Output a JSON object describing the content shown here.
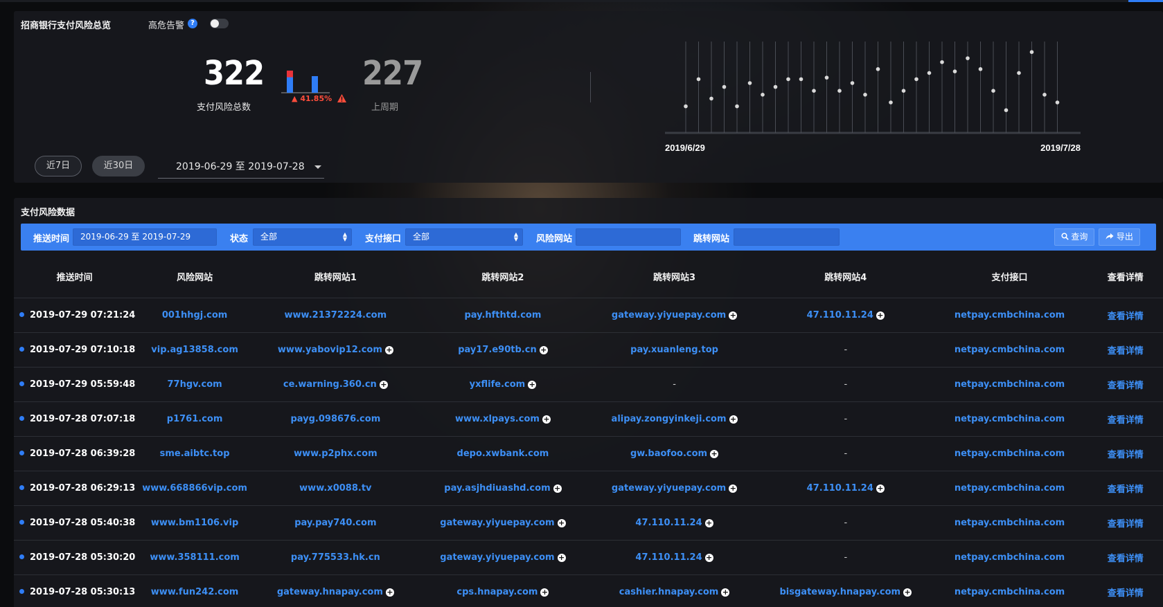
{
  "overview": {
    "title": "招商银行支付风险总览",
    "alert_label": "高危告警",
    "help_glyph": "?",
    "total_value": "322",
    "total_caption": "支付风险总数",
    "change_text": "41.85%",
    "change_bars": [
      0.8,
      0.6
    ],
    "last_value": "227",
    "last_caption": "上周期",
    "timeline_start": "2019/6/29",
    "timeline_end": "2019/7/28",
    "timeline_levels": [
      0.2,
      0.55,
      0.3,
      0.45,
      0.2,
      0.5,
      0.35,
      0.45,
      0.55,
      0.55,
      0.4,
      0.57,
      0.4,
      0.5,
      0.35,
      0.68,
      0.25,
      0.4,
      0.55,
      0.63,
      0.77,
      0.65,
      0.82,
      0.68,
      0.4,
      0.15,
      0.63,
      0.9,
      0.35,
      0.25
    ],
    "btn_7d": "近7日",
    "btn_30d": "近30日",
    "date_range": "2019-06-29 至 2019-07-28"
  },
  "data_panel": {
    "title": "支付风险数据",
    "filters": {
      "push_time_label": "推送时间",
      "push_time_value": "2019-06-29 至 2019-07-29",
      "status_label": "状态",
      "status_value": "全部",
      "interface_label": "支付接口",
      "interface_value": "全部",
      "risk_site_label": "风险网站",
      "jump_site_label": "跳转网站",
      "query_label": "查询",
      "export_label": "导出"
    },
    "columns": [
      "推送时间",
      "风险网站",
      "跳转网站1",
      "跳转网站2",
      "跳转网站3",
      "跳转网站4",
      "支付接口",
      "查看详情"
    ],
    "detail_label": "查看详情",
    "rows": [
      {
        "time": "2019-07-29 07:21:24",
        "risk": "001hhgj.com",
        "j1": "www.21372224.com",
        "j1p": false,
        "j2": "pay.hfthtd.com",
        "j2p": false,
        "j3": "gateway.yiyuepay.com",
        "j3p": true,
        "j4": "47.110.11.24",
        "j4p": true,
        "iface": "netpay.cmbchina.com"
      },
      {
        "time": "2019-07-29 07:10:18",
        "risk": "vip.ag13858.com",
        "j1": "www.yabovip12.com",
        "j1p": true,
        "j2": "pay17.e90tb.cn",
        "j2p": true,
        "j3": "pay.xuanleng.top",
        "j3p": false,
        "j4": "-",
        "j4p": false,
        "iface": "netpay.cmbchina.com"
      },
      {
        "time": "2019-07-29 05:59:48",
        "risk": "77hgv.com",
        "j1": "ce.warning.360.cn",
        "j1p": true,
        "j2": "yxflife.com",
        "j2p": true,
        "j3": "-",
        "j3p": false,
        "j4": "-",
        "j4p": false,
        "iface": "netpay.cmbchina.com"
      },
      {
        "time": "2019-07-28 07:07:18",
        "risk": "p1761.com",
        "j1": "payg.098676.com",
        "j1p": false,
        "j2": "www.xlpays.com",
        "j2p": true,
        "j3": "alipay.zongyinkeji.com",
        "j3p": true,
        "j4": "-",
        "j4p": false,
        "iface": "netpay.cmbchina.com"
      },
      {
        "time": "2019-07-28 06:39:28",
        "risk": "sme.aibtc.top",
        "j1": "www.p2phx.com",
        "j1p": false,
        "j2": "depo.xwbank.com",
        "j2p": false,
        "j3": "gw.baofoo.com",
        "j3p": true,
        "j4": "-",
        "j4p": false,
        "iface": "netpay.cmbchina.com"
      },
      {
        "time": "2019-07-28 06:29:13",
        "risk": "www.668866vip.com",
        "j1": "www.x0088.tv",
        "j1p": false,
        "j2": "pay.asjhdiuashd.com",
        "j2p": true,
        "j3": "gateway.yiyuepay.com",
        "j3p": true,
        "j4": "47.110.11.24",
        "j4p": true,
        "iface": "netpay.cmbchina.com"
      },
      {
        "time": "2019-07-28 05:40:38",
        "risk": "www.bm1106.vip",
        "j1": "pay.pay740.com",
        "j1p": false,
        "j2": "gateway.yiyuepay.com",
        "j2p": true,
        "j3": "47.110.11.24",
        "j3p": true,
        "j4": "-",
        "j4p": false,
        "iface": "netpay.cmbchina.com"
      },
      {
        "time": "2019-07-28 05:30:20",
        "risk": "www.358111.com",
        "j1": "pay.775533.hk.cn",
        "j1p": false,
        "j2": "gateway.yiyuepay.com",
        "j2p": true,
        "j3": "47.110.11.24",
        "j3p": true,
        "j4": "-",
        "j4p": false,
        "iface": "netpay.cmbchina.com"
      },
      {
        "time": "2019-07-28 05:30:13",
        "risk": "www.fun242.com",
        "j1": "gateway.hnapay.com",
        "j1p": true,
        "j2": "cps.hnapay.com",
        "j2p": true,
        "j3": "cashier.hnapay.com",
        "j3p": true,
        "j4": "bisgateway.hnapay.com",
        "j4p": true,
        "iface": "netpay.cmbchina.com"
      }
    ]
  },
  "colors": {
    "accent": "#2f7df6",
    "filter_bar": "#3a80f0",
    "link": "#3d8ff5",
    "alert": "#ff4d3b",
    "bar_top": "#e8333a"
  }
}
